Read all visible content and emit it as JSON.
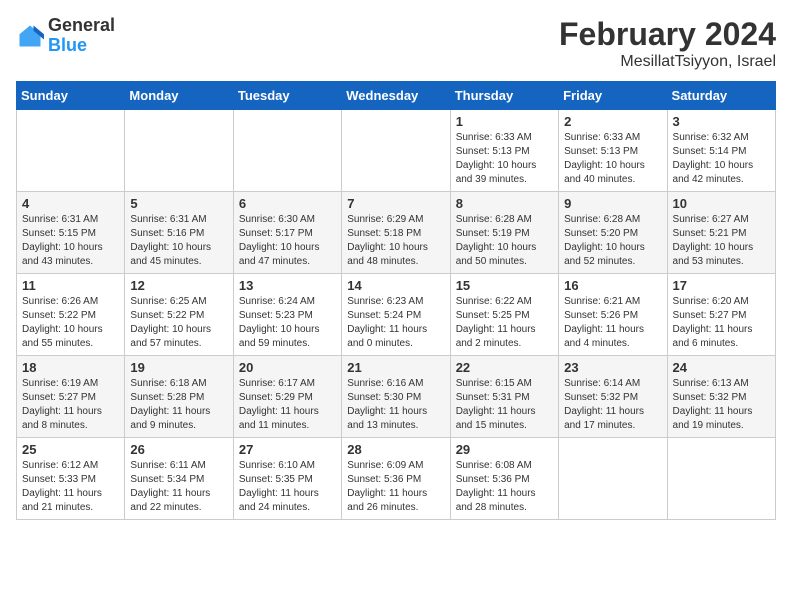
{
  "header": {
    "logo_general": "General",
    "logo_blue": "Blue",
    "title": "February 2024",
    "subtitle": "MesillatTsiyyon, Israel"
  },
  "days_of_week": [
    "Sunday",
    "Monday",
    "Tuesday",
    "Wednesday",
    "Thursday",
    "Friday",
    "Saturday"
  ],
  "weeks": [
    [
      {
        "day": "",
        "info": ""
      },
      {
        "day": "",
        "info": ""
      },
      {
        "day": "",
        "info": ""
      },
      {
        "day": "",
        "info": ""
      },
      {
        "day": "1",
        "info": "Sunrise: 6:33 AM\nSunset: 5:13 PM\nDaylight: 10 hours and 39 minutes."
      },
      {
        "day": "2",
        "info": "Sunrise: 6:33 AM\nSunset: 5:13 PM\nDaylight: 10 hours and 40 minutes."
      },
      {
        "day": "3",
        "info": "Sunrise: 6:32 AM\nSunset: 5:14 PM\nDaylight: 10 hours and 42 minutes."
      }
    ],
    [
      {
        "day": "4",
        "info": "Sunrise: 6:31 AM\nSunset: 5:15 PM\nDaylight: 10 hours and 43 minutes."
      },
      {
        "day": "5",
        "info": "Sunrise: 6:31 AM\nSunset: 5:16 PM\nDaylight: 10 hours and 45 minutes."
      },
      {
        "day": "6",
        "info": "Sunrise: 6:30 AM\nSunset: 5:17 PM\nDaylight: 10 hours and 47 minutes."
      },
      {
        "day": "7",
        "info": "Sunrise: 6:29 AM\nSunset: 5:18 PM\nDaylight: 10 hours and 48 minutes."
      },
      {
        "day": "8",
        "info": "Sunrise: 6:28 AM\nSunset: 5:19 PM\nDaylight: 10 hours and 50 minutes."
      },
      {
        "day": "9",
        "info": "Sunrise: 6:28 AM\nSunset: 5:20 PM\nDaylight: 10 hours and 52 minutes."
      },
      {
        "day": "10",
        "info": "Sunrise: 6:27 AM\nSunset: 5:21 PM\nDaylight: 10 hours and 53 minutes."
      }
    ],
    [
      {
        "day": "11",
        "info": "Sunrise: 6:26 AM\nSunset: 5:22 PM\nDaylight: 10 hours and 55 minutes."
      },
      {
        "day": "12",
        "info": "Sunrise: 6:25 AM\nSunset: 5:22 PM\nDaylight: 10 hours and 57 minutes."
      },
      {
        "day": "13",
        "info": "Sunrise: 6:24 AM\nSunset: 5:23 PM\nDaylight: 10 hours and 59 minutes."
      },
      {
        "day": "14",
        "info": "Sunrise: 6:23 AM\nSunset: 5:24 PM\nDaylight: 11 hours and 0 minutes."
      },
      {
        "day": "15",
        "info": "Sunrise: 6:22 AM\nSunset: 5:25 PM\nDaylight: 11 hours and 2 minutes."
      },
      {
        "day": "16",
        "info": "Sunrise: 6:21 AM\nSunset: 5:26 PM\nDaylight: 11 hours and 4 minutes."
      },
      {
        "day": "17",
        "info": "Sunrise: 6:20 AM\nSunset: 5:27 PM\nDaylight: 11 hours and 6 minutes."
      }
    ],
    [
      {
        "day": "18",
        "info": "Sunrise: 6:19 AM\nSunset: 5:27 PM\nDaylight: 11 hours and 8 minutes."
      },
      {
        "day": "19",
        "info": "Sunrise: 6:18 AM\nSunset: 5:28 PM\nDaylight: 11 hours and 9 minutes."
      },
      {
        "day": "20",
        "info": "Sunrise: 6:17 AM\nSunset: 5:29 PM\nDaylight: 11 hours and 11 minutes."
      },
      {
        "day": "21",
        "info": "Sunrise: 6:16 AM\nSunset: 5:30 PM\nDaylight: 11 hours and 13 minutes."
      },
      {
        "day": "22",
        "info": "Sunrise: 6:15 AM\nSunset: 5:31 PM\nDaylight: 11 hours and 15 minutes."
      },
      {
        "day": "23",
        "info": "Sunrise: 6:14 AM\nSunset: 5:32 PM\nDaylight: 11 hours and 17 minutes."
      },
      {
        "day": "24",
        "info": "Sunrise: 6:13 AM\nSunset: 5:32 PM\nDaylight: 11 hours and 19 minutes."
      }
    ],
    [
      {
        "day": "25",
        "info": "Sunrise: 6:12 AM\nSunset: 5:33 PM\nDaylight: 11 hours and 21 minutes."
      },
      {
        "day": "26",
        "info": "Sunrise: 6:11 AM\nSunset: 5:34 PM\nDaylight: 11 hours and 22 minutes."
      },
      {
        "day": "27",
        "info": "Sunrise: 6:10 AM\nSunset: 5:35 PM\nDaylight: 11 hours and 24 minutes."
      },
      {
        "day": "28",
        "info": "Sunrise: 6:09 AM\nSunset: 5:36 PM\nDaylight: 11 hours and 26 minutes."
      },
      {
        "day": "29",
        "info": "Sunrise: 6:08 AM\nSunset: 5:36 PM\nDaylight: 11 hours and 28 minutes."
      },
      {
        "day": "",
        "info": ""
      },
      {
        "day": "",
        "info": ""
      }
    ]
  ]
}
